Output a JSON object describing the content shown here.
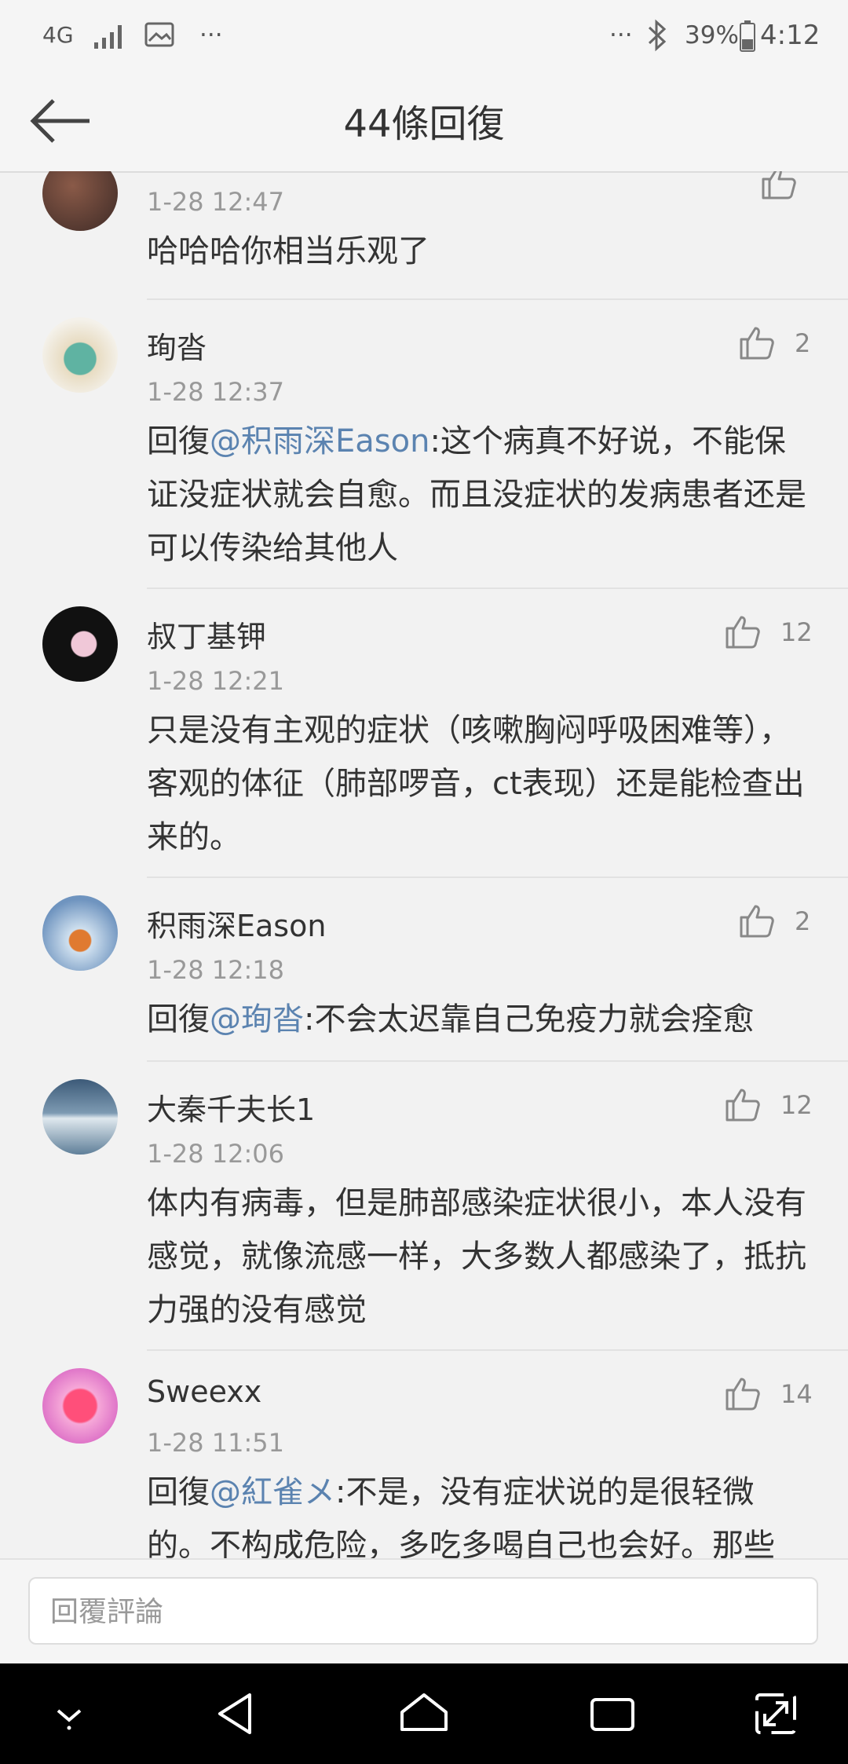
{
  "status_bar": {
    "network": "4G",
    "dots_left": "···",
    "dots_right": "···",
    "battery": "39%",
    "time": "4:12"
  },
  "header": {
    "title": "44條回復"
  },
  "comments": [
    {
      "username": "",
      "time": "1-28 12:47",
      "body_prefix": "",
      "mention": "",
      "body": "哈哈哈你相当乐观了",
      "likes": ""
    },
    {
      "username": "珣沓",
      "time": "1-28 12:37",
      "body_prefix": "回復",
      "mention": "@积雨深Eason",
      "body": ":这个病真不好说，不能保证没症状就会自愈。而且没症状的发病患者还是可以传染给其他人",
      "likes": "2"
    },
    {
      "username": "叔丁基钾",
      "time": "1-28 12:21",
      "body_prefix": "",
      "mention": "",
      "body": "只是没有主观的症状（咳嗽胸闷呼吸困难等），客观的体征（肺部啰音，ct表现）还是能检查出来的。",
      "likes": "12"
    },
    {
      "username": "积雨深Eason",
      "time": "1-28 12:18",
      "body_prefix": "回復",
      "mention": "@珣沓",
      "body": ":不会太迟靠自己免疫力就会痊愈",
      "likes": "2"
    },
    {
      "username": "大秦千夫长1",
      "time": "1-28 12:06",
      "body_prefix": "",
      "mention": "",
      "body": "体内有病毒，但是肺部感染症状很小，本人没有感觉，就像流感一样，大多数人都感染了，抵抗力强的没有感觉",
      "likes": "12"
    },
    {
      "username": "Sweexx",
      "time": "1-28 11:51",
      "body_prefix": "回復",
      "mention": "@紅雀メ",
      "body": ":不是，没有症状说的是很轻微的。不构成危险，多吃多喝自己也会好。那些",
      "likes": "14"
    }
  ],
  "reply_bar": {
    "placeholder": "回覆評論"
  },
  "colors": {
    "mention": "#5b83b0",
    "background": "#f2f2f2",
    "nav": "#000000"
  }
}
